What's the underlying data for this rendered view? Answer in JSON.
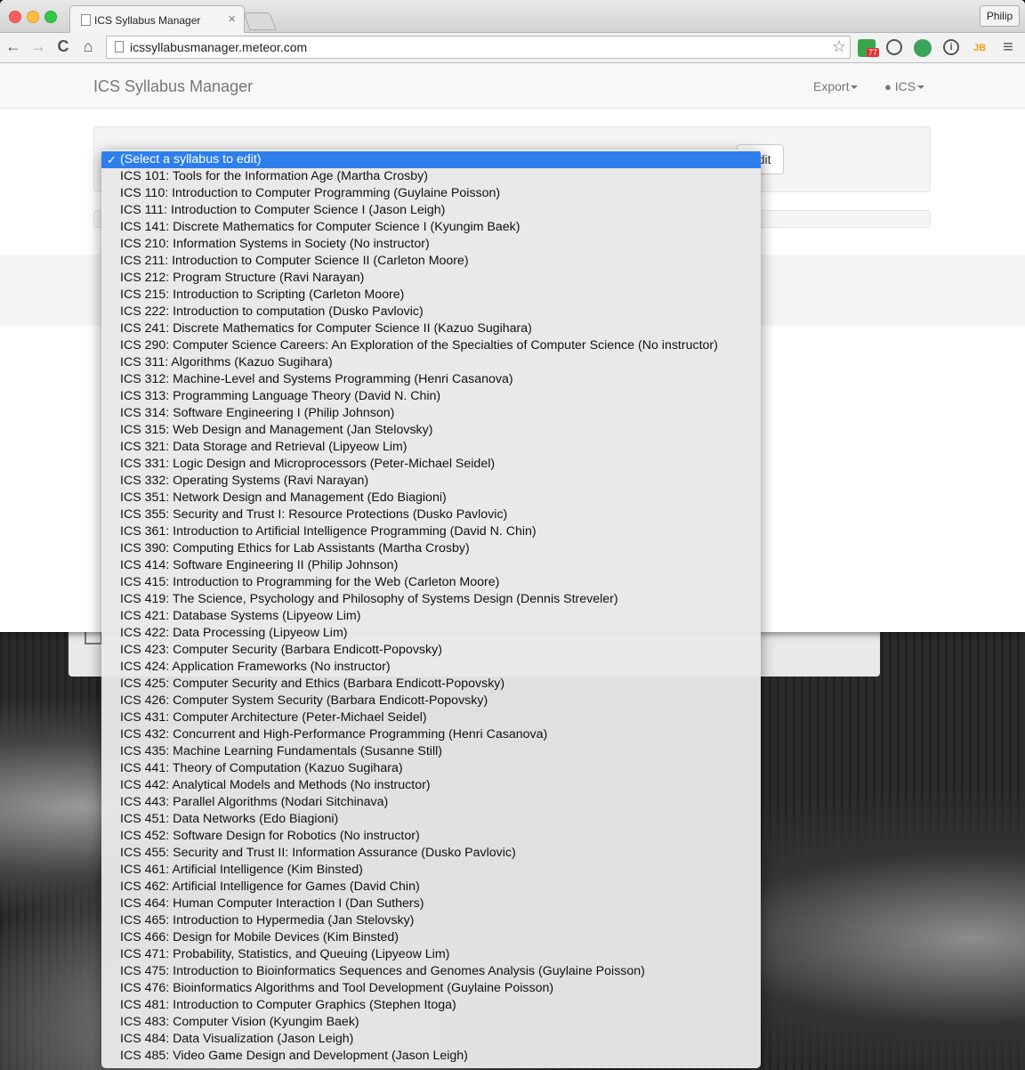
{
  "browser": {
    "tab_title": "ICS Syllabus Manager",
    "tab_close": "×",
    "profile_name": "Philip",
    "url": "icssyllabusmanager.meteor.com",
    "back_icon": "←",
    "forward_icon": "→",
    "reload_icon": "C",
    "home_icon": "⌂",
    "bookmark_icon": "☆",
    "menu_icon": "≡",
    "extension_badge": "77",
    "ext_label_jb": "JB"
  },
  "navbar": {
    "brand": "ICS Syllabus Manager",
    "export_label": "Export",
    "user_label": "ICS"
  },
  "form": {
    "edit_button_label": "Edit"
  },
  "dropdown": {
    "selected_check": "✓",
    "selected": "(Select a syllabus to edit)",
    "options": [
      "ICS 101: Tools for the Information Age (Martha Crosby)",
      "ICS 110: Introduction to Computer Programming (Guylaine Poisson)",
      "ICS 111: Introduction to Computer Science I (Jason Leigh)",
      "ICS 141: Discrete Mathematics for Computer Science I (Kyungim Baek)",
      "ICS 210: Information Systems in Society (No instructor)",
      "ICS 211: Introduction to Computer Science II (Carleton Moore)",
      "ICS 212: Program Structure (Ravi Narayan)",
      "ICS 215: Introduction to Scripting (Carleton Moore)",
      "ICS 222: Introduction to computation (Dusko Pavlovic)",
      "ICS 241: Discrete Mathematics for Computer Science II (Kazuo Sugihara)",
      "ICS 290: Computer Science Careers: An Exploration of the Specialties of Computer Science (No instructor)",
      "ICS 311: Algorithms (Kazuo Sugihara)",
      "ICS 312: Machine-Level and Systems Programming (Henri Casanova)",
      "ICS 313: Programming Language Theory (David N. Chin)",
      "ICS 314: Software Engineering I (Philip Johnson)",
      "ICS 315: Web Design and Management (Jan Stelovsky)",
      "ICS 321: Data Storage and Retrieval (Lipyeow Lim)",
      "ICS 331: Logic Design and Microprocessors (Peter-Michael Seidel)",
      "ICS 332: Operating Systems (Ravi Narayan)",
      "ICS 351: Network Design and Management (Edo Biagioni)",
      "ICS 355: Security and Trust I: Resource Protections (Dusko Pavlovic)",
      "ICS 361: Introduction to Artificial Intelligence Programming (David N. Chin)",
      "ICS 390: Computing Ethics for Lab Assistants (Martha Crosby)",
      "ICS 414: Software Engineering II (Philip Johnson)",
      "ICS 415: Introduction to Programming for the Web (Carleton Moore)",
      "ICS 419: The Science, Psychology and Philosophy of Systems Design (Dennis Streveler)",
      "ICS 421: Database Systems (Lipyeow Lim)",
      "ICS 422: Data Processing (Lipyeow Lim)",
      "ICS 423: Computer Security (Barbara Endicott-Popovsky)",
      "ICS 424: Application Frameworks (No instructor)",
      "ICS 425: Computer Security and Ethics (Barbara Endicott-Popovsky)",
      "ICS 426: Computer System Security (Barbara Endicott-Popovsky)",
      "ICS 431: Computer Architecture (Peter-Michael Seidel)",
      "ICS 432: Concurrent and High-Performance Programming (Henri Casanova)",
      "ICS 435: Machine Learning Fundamentals (Susanne Still)",
      "ICS 441: Theory of Computation (Kazuo Sugihara)",
      "ICS 442: Analytical Models and Methods (No instructor)",
      "ICS 443: Parallel Algorithms (Nodari Sitchinava)",
      "ICS 451: Data Networks (Edo Biagioni)",
      "ICS 452: Software Design for Robotics (No instructor)",
      "ICS 455: Security and Trust II: Information Assurance (Dusko Pavlovic)",
      "ICS 461: Artificial Intelligence (Kim Binsted)",
      "ICS 462: Artificial Intelligence for Games (David Chin)",
      "ICS 464: Human Computer Interaction I (Dan Suthers)",
      "ICS 465: Introduction to Hypermedia (Jan Stelovsky)",
      "ICS 466: Design for Mobile Devices (Kim Binsted)",
      "ICS 471: Probability, Statistics, and Queuing (Lipyeow Lim)",
      "ICS 475: Introduction to Bioinformatics Sequences and Genomes Analysis (Guylaine Poisson)",
      "ICS 476: Bioinformatics Algorithms and Tool Development (Guylaine Poisson)",
      "ICS 481: Introduction to Computer Graphics (Stephen Itoga)",
      "ICS 483: Computer Vision (Kyungim Baek)",
      "ICS 484: Data Visualization (Jason Leigh)",
      "ICS 485: Video Game Design and Development (Jason Leigh)"
    ]
  }
}
